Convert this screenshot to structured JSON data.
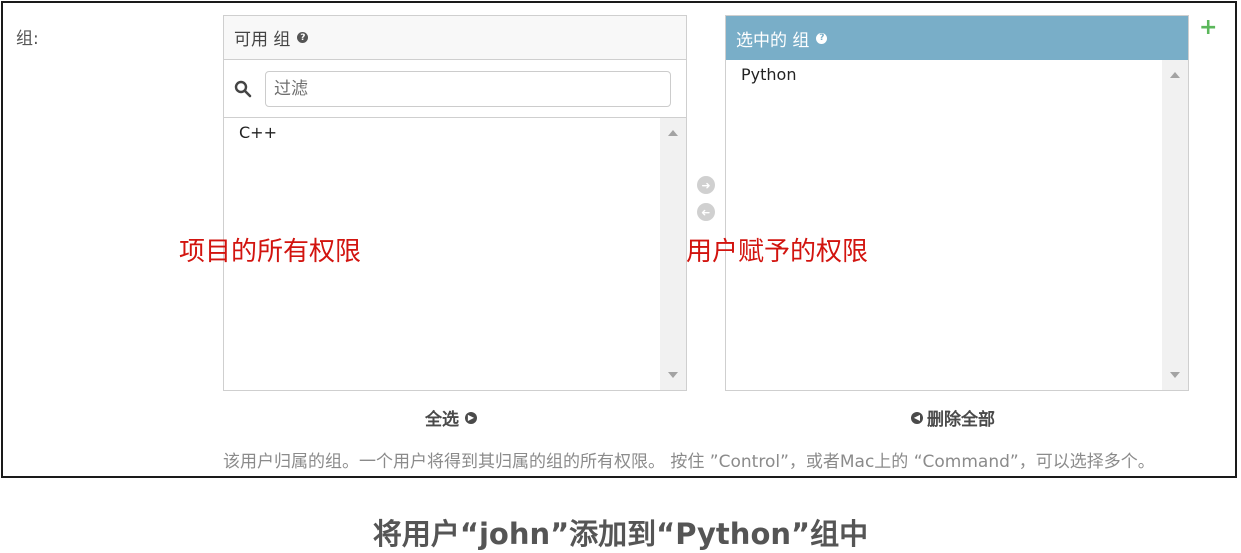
{
  "field_label": "组:",
  "available": {
    "title": "可用 组",
    "help_icon": "question-circle-icon",
    "filter_placeholder": "过滤",
    "search_icon": "search-icon",
    "options": [
      "C++"
    ],
    "choose_all_label": "全选"
  },
  "chosen": {
    "title": "选中的 组",
    "help_icon": "question-circle-icon",
    "options": [
      "Python"
    ],
    "remove_all_label": "删除全部"
  },
  "add_button": "+",
  "annotations": {
    "left": "项目的所有权限",
    "right": "用户赋予的权限"
  },
  "help_text": "该用户归属的组。一个用户将得到其归属的组的所有权限。 按住 ”Control”，或者Mac上的 “Command”，可以选择多个。",
  "caption": "将用户“john”添加到“Python”组中",
  "colors": {
    "chosen_header_bg": "#79aec8",
    "annotation_red": "#d2140f",
    "add_green": "#5bb75b"
  }
}
